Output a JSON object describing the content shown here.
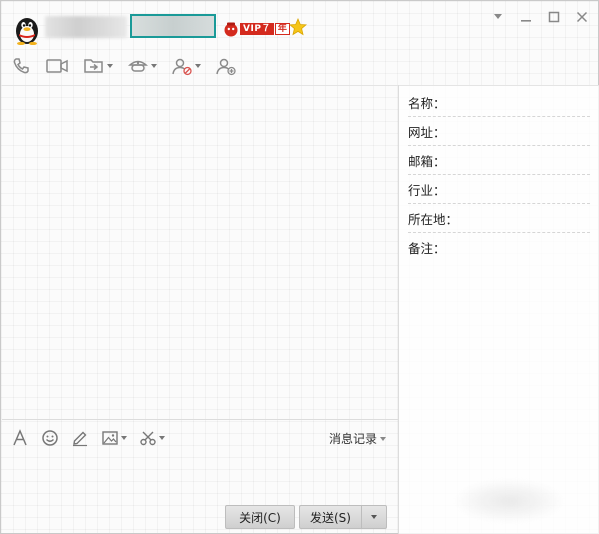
{
  "header": {
    "vip_label": "VIP７",
    "vip_year": "年"
  },
  "toolbar": {
    "icons": [
      "phone-icon",
      "video-icon",
      "file-transfer-icon",
      "app-center-icon",
      "block-user-icon",
      "add-friend-icon"
    ]
  },
  "input_toolbar": {
    "icons": [
      "font-icon",
      "emoji-icon",
      "handwrite-icon",
      "image-icon",
      "screenshot-icon"
    ],
    "msg_record_label": "消息记录"
  },
  "buttons": {
    "close_label": "关闭(C)",
    "send_label": "发送(S)"
  },
  "info_panel": {
    "rows": [
      {
        "label": "名称："
      },
      {
        "label": "网址："
      },
      {
        "label": "邮箱："
      },
      {
        "label": "行业："
      },
      {
        "label": "所在地："
      },
      {
        "label": "备注："
      }
    ]
  },
  "colors": {
    "accent": "#1a9a98",
    "vip_red": "#d42a1e",
    "icon_gray": "#8a8a8a"
  }
}
